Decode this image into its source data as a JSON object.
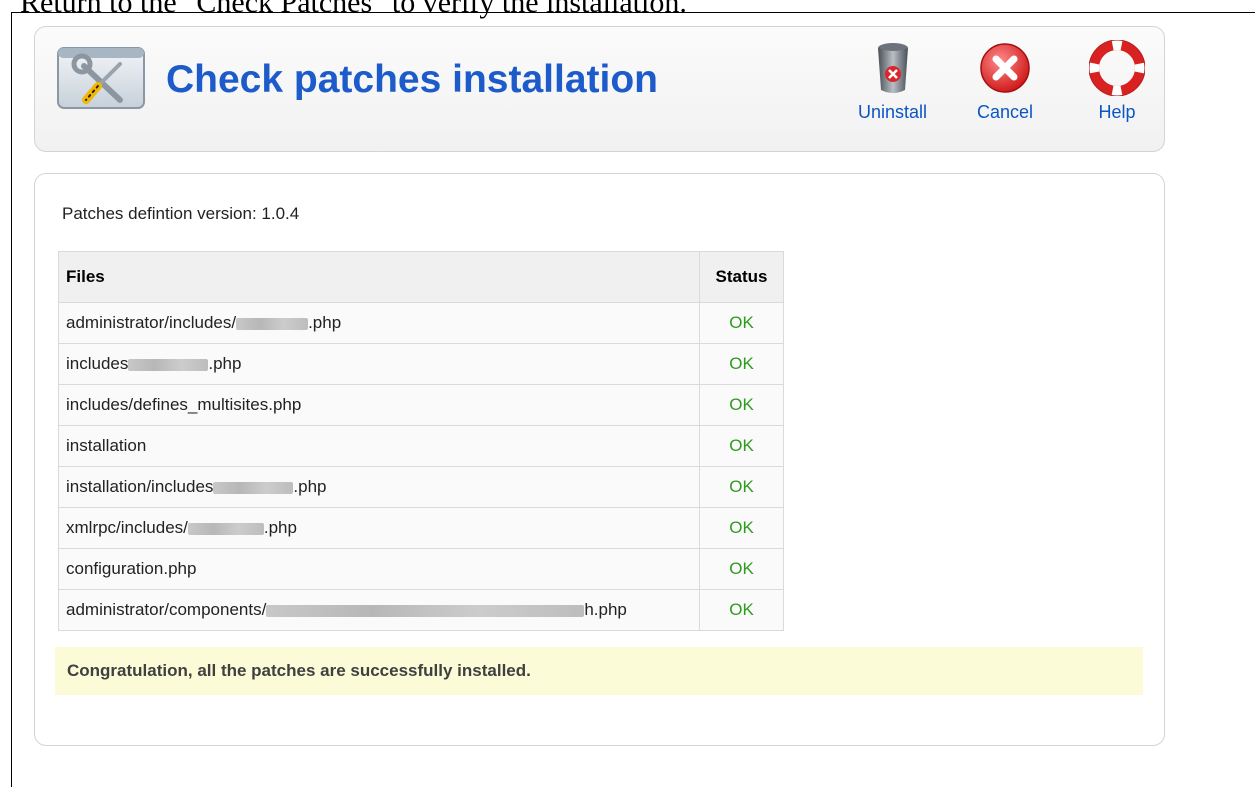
{
  "caption": "Return to the \"Check Patches\" to verify the installation.",
  "header": {
    "title": "Check patches installation",
    "icon": "tools-icon"
  },
  "toolbar": {
    "buttons": [
      {
        "label": "Uninstall",
        "icon": "trash-can-icon"
      },
      {
        "label": "Cancel",
        "icon": "cancel-icon"
      },
      {
        "label": "Help",
        "icon": "lifebuoy-icon"
      }
    ]
  },
  "version_text": "Patches defintion version: 1.0.4",
  "table": {
    "columns": [
      "Files",
      "Status"
    ],
    "rows": [
      {
        "prefix": "administrator/includes/",
        "suffix": ".php",
        "status": "OK"
      },
      {
        "prefix": "includes",
        "suffix": ".php",
        "status": "OK"
      },
      {
        "prefix": "includes/defines_multisites.php",
        "suffix": "",
        "status": "OK"
      },
      {
        "prefix": "installation",
        "suffix": "",
        "status": "OK"
      },
      {
        "prefix": "installation/includes",
        "suffix": ".php",
        "status": "OK"
      },
      {
        "prefix": "xmlrpc/includes/",
        "suffix": ".php",
        "status": "OK"
      },
      {
        "prefix": "configuration.php",
        "suffix": "",
        "status": "OK"
      },
      {
        "prefix": "administrator/components/",
        "suffix": "h.php",
        "status": "OK"
      }
    ]
  },
  "message": "Congratulation, all the patches are successfully installed.",
  "colors": {
    "title": "#1c5bc9",
    "link": "#0b55c4",
    "ok": "#2e9a1e",
    "message_bg": "#fbfbd8"
  }
}
